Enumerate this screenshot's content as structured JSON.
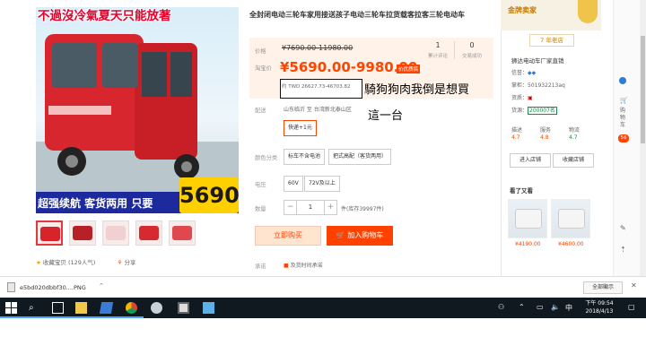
{
  "product": {
    "promo_top": "不過沒冷氣夏天只能放著",
    "promo_bottom": "超强续航 客货两用 只要",
    "promo_price": "5690",
    "title": "全封闭电动三轮车家用接送孩子电动三轮车拉货载客拉客三轮电动车",
    "fav_label": "收藏宝贝 (129人气)",
    "share_label": "分享"
  },
  "price": {
    "price_label": "价格",
    "original_range": "¥7690.00-11980.00",
    "taobao_label": "淘宝价",
    "current_range": "¥5690.00-9980.00",
    "badge": "价优质稿",
    "twd_text": "约 TWD 26627.73-46703.82",
    "reviews_count": "1",
    "reviews_label": "累计评论",
    "sales_count": "0",
    "sales_label": "交易成功"
  },
  "annotation": {
    "line1": "騎狗狗肉我倒是想買",
    "line2": "這一台"
  },
  "shipping": {
    "label": "配送",
    "from": "山东临沂 至 台湾新北泰山区",
    "option": "快递+1元"
  },
  "options": {
    "color_label": "颜色分类",
    "color_opts": [
      "标车不含电池",
      "把式高配（客货两用）"
    ],
    "voltage_label": "电压",
    "voltage_opts": [
      "60V",
      "72V及以上"
    ],
    "qty_label": "数量",
    "qty_value": "1",
    "stock": "件(库存39997件)",
    "promise_label": "承诺",
    "promise": "及货时间承诺"
  },
  "buttons": {
    "buy": "立即购买",
    "cart": "加入购物车"
  },
  "shop": {
    "gold_label": "金牌卖家",
    "years": "7 年老店",
    "name": "狮达电动车厂家直销",
    "credit_label": "信誉：",
    "phone_label": "掌柜：",
    "phone": "501932213aq",
    "service_label": "资质：",
    "rating_label": "货源：",
    "rating_value": "200007名",
    "scores": [
      {
        "label": "描述",
        "value": "4.7"
      },
      {
        "label": "服务",
        "value": "4.8"
      },
      {
        "label": "物流",
        "value": "4.7"
      }
    ],
    "enter_shop": "进入店铺",
    "fav_shop": "收藏店铺",
    "see_also": "看了又看",
    "rec": [
      {
        "price": "¥4190.00"
      },
      {
        "price": "¥4600.00"
      }
    ]
  },
  "sidebar": {
    "cart_label": "购物车",
    "cart_count": "56"
  },
  "download": {
    "filename": "e5bd020dbbf30....PNG",
    "show_all": "全部顯示"
  },
  "taskbar": {
    "time": "下午 09:54",
    "date": "2018/4/13"
  },
  "colors": {
    "accent": "#ff4400",
    "brand_red": "#e4002b",
    "taskbar": "#101820"
  }
}
